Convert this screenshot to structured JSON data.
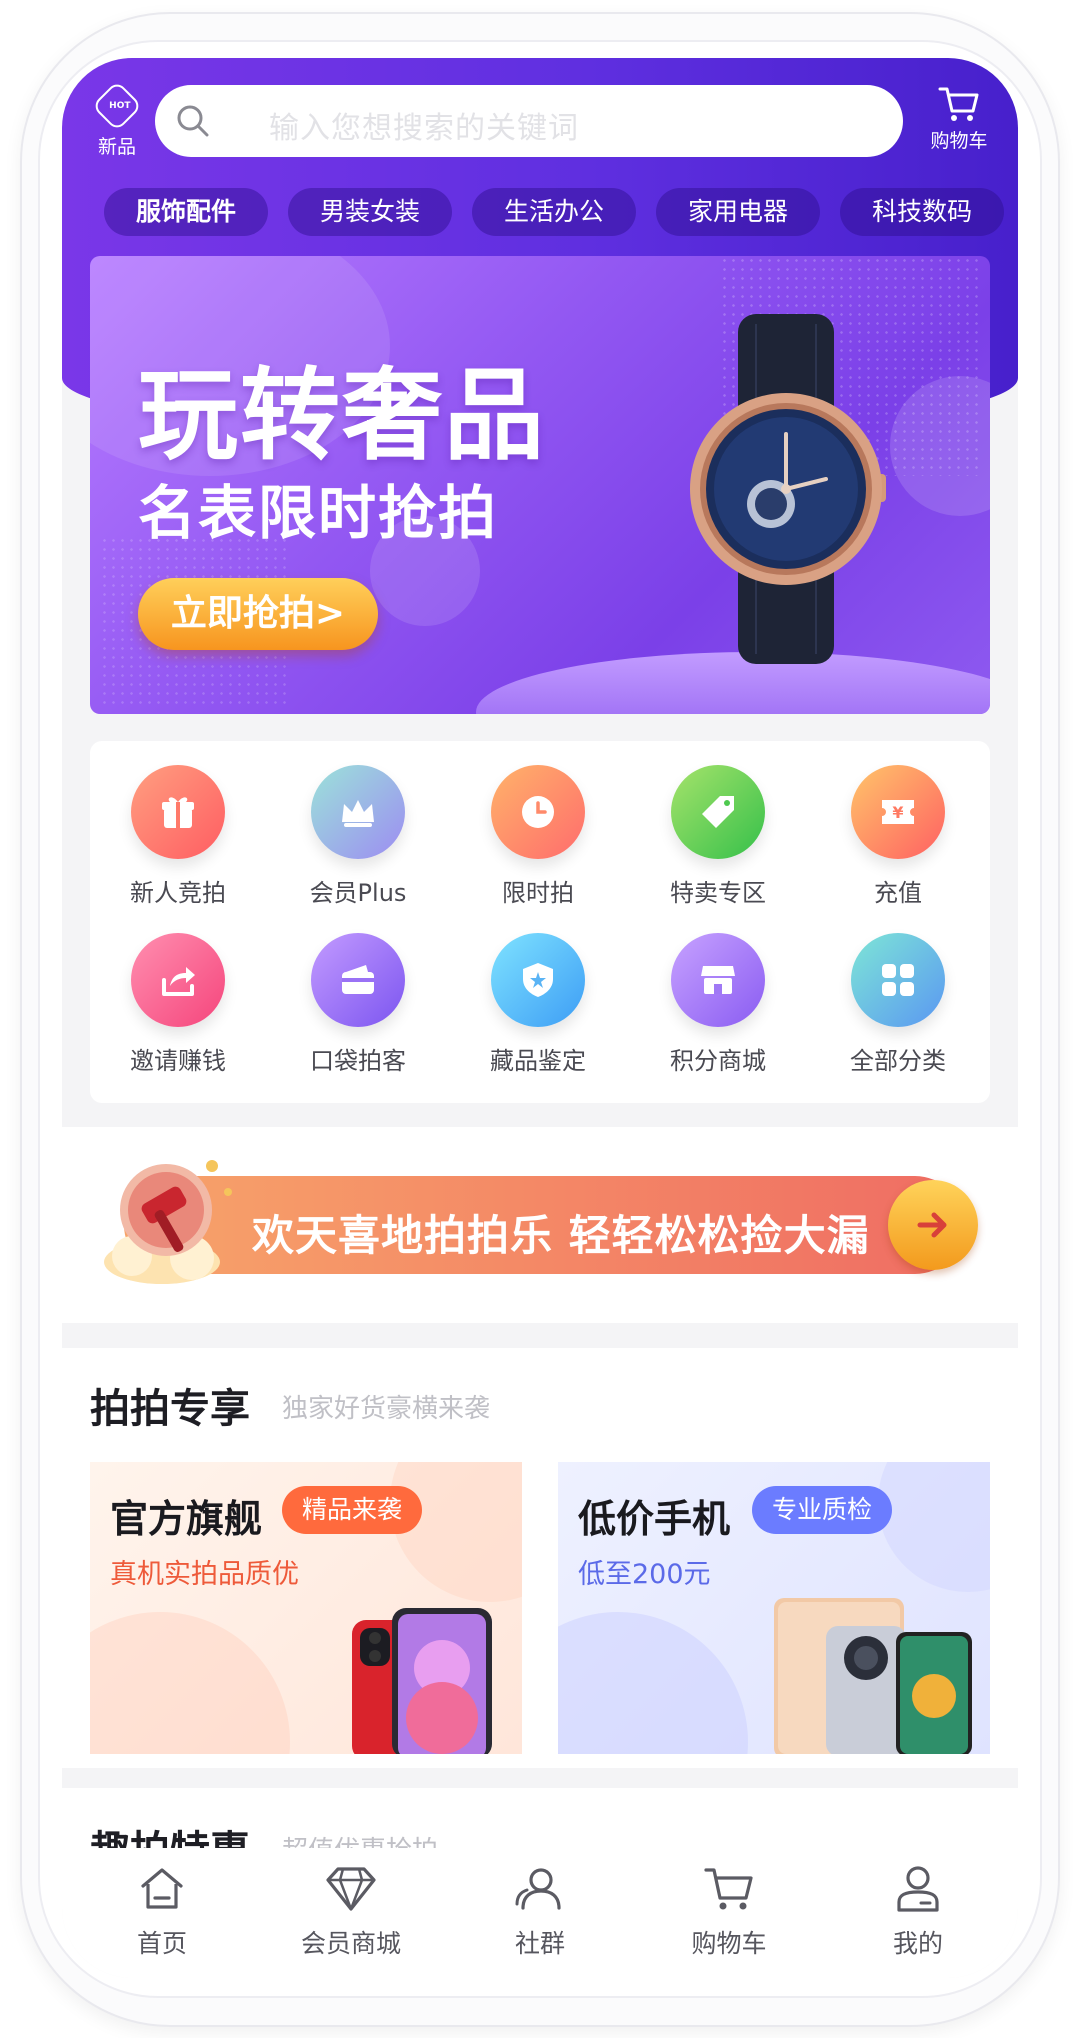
{
  "header": {
    "hot_badge": "HOT",
    "hot_label": "新品",
    "search_placeholder": "输入您想搜索的关键词",
    "cart_label": "购物车"
  },
  "categories": [
    "服饰配件",
    "男装女装",
    "生活办公",
    "家用电器",
    "科技数码"
  ],
  "banner": {
    "title": "玩转奢品",
    "subtitle": "名表限时抢拍",
    "button": "立即抢拍>"
  },
  "grid": [
    {
      "label": "新人竞拍",
      "icon": "gift-icon",
      "color_a": "#ff9f80",
      "color_b": "#ff5d62"
    },
    {
      "label": "会员Plus",
      "icon": "crown-icon",
      "color_a": "#9be3d9",
      "color_b": "#9d8cf2"
    },
    {
      "label": "限时拍",
      "icon": "clock-icon",
      "color_a": "#ffb36a",
      "color_b": "#ff6c6c"
    },
    {
      "label": "特卖专区",
      "icon": "tag-icon",
      "color_a": "#a6e36b",
      "color_b": "#35c04a"
    },
    {
      "label": "充值",
      "icon": "coupon-icon",
      "color_a": "#ffc56a",
      "color_b": "#ff6062"
    },
    {
      "label": "邀请赚钱",
      "icon": "share-icon",
      "color_a": "#ff8fb0",
      "color_b": "#f5457c"
    },
    {
      "label": "口袋拍客",
      "icon": "wallet-icon",
      "color_a": "#c39bff",
      "color_b": "#7c55f0"
    },
    {
      "label": "藏品鉴定",
      "icon": "shield-icon",
      "color_a": "#7fe3ff",
      "color_b": "#3d9df5"
    },
    {
      "label": "积分商城",
      "icon": "store-icon",
      "color_a": "#c7a2ff",
      "color_b": "#8a5cf2"
    },
    {
      "label": "全部分类",
      "icon": "grid-icon",
      "color_a": "#7ee6d6",
      "color_b": "#5a97f2"
    }
  ],
  "promo": {
    "text": "欢天喜地拍拍乐 轻轻松松捡大漏"
  },
  "exclusive": {
    "title": "拍拍专享",
    "subtitle": "独家好货豪横来袭",
    "tiles": [
      {
        "title": "官方旗舰",
        "tag": "精品来袭",
        "desc": "真机实拍品质优"
      },
      {
        "title": "低价手机",
        "tag": "专业质检",
        "desc": "低至200元"
      }
    ]
  },
  "section2": {
    "title": "趣拍特惠",
    "subtitle": "超值优惠抢拍"
  },
  "nav": [
    {
      "label": "首页",
      "icon": "home-icon"
    },
    {
      "label": "会员商城",
      "icon": "diamond-icon"
    },
    {
      "label": "社群",
      "icon": "community-icon"
    },
    {
      "label": "购物车",
      "icon": "cart-icon"
    },
    {
      "label": "我的",
      "icon": "profile-icon"
    }
  ],
  "colors": {
    "header_start": "#7a37e8",
    "header_end": "#4720cc",
    "tag_orange": "#ff6a3d",
    "tag_blue": "#6b7cff",
    "desc_orange": "#ee5a3a",
    "desc_blue": "#5b6ae8"
  }
}
